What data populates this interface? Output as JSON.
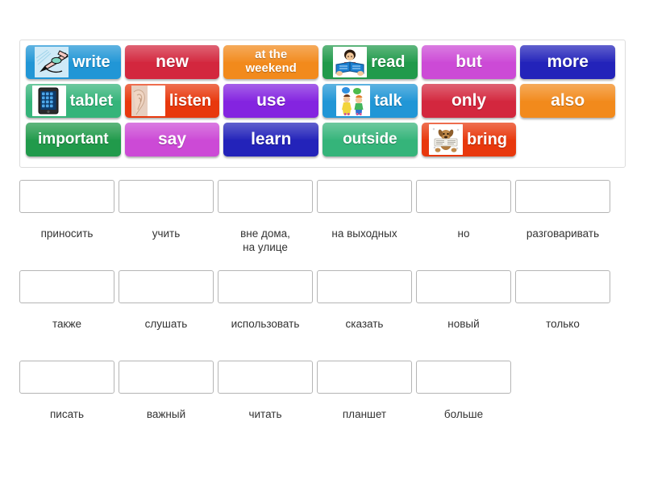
{
  "activity": {
    "type": "match-up-word-tiles",
    "tile_bank": {
      "rows": [
        [
          {
            "label": "write",
            "color": "#2196d6",
            "picture": "hand-writing-icon",
            "has_picture": true
          },
          {
            "label": "new",
            "color": "#d3273e",
            "picture": null,
            "has_picture": false
          },
          {
            "label": "at the\nweekend",
            "color": "#f28a1c",
            "picture": null,
            "has_picture": false,
            "two_line": true
          },
          {
            "label": "read",
            "color": "#219a4b",
            "picture": "child-reading-icon",
            "has_picture": true
          },
          {
            "label": "but",
            "color": "#cc4ad6",
            "picture": null,
            "has_picture": false
          },
          {
            "label": "more",
            "color": "#2323ba",
            "picture": null,
            "has_picture": false
          }
        ],
        [
          {
            "label": "tablet",
            "color": "#35b47a",
            "picture": "tablet-device-icon",
            "has_picture": true
          },
          {
            "label": "listen",
            "color": "#e8380d",
            "picture": "ear-listening-icon",
            "has_picture": true
          },
          {
            "label": "use",
            "color": "#8424e0",
            "picture": null,
            "has_picture": false
          },
          {
            "label": "talk",
            "color": "#2196d6",
            "picture": "two-kids-talking-icon",
            "has_picture": true
          },
          {
            "label": "only",
            "color": "#d3273e",
            "picture": null,
            "has_picture": false
          },
          {
            "label": "also",
            "color": "#f28a1c",
            "picture": null,
            "has_picture": false
          }
        ],
        [
          {
            "label": "important",
            "color": "#219a4b",
            "picture": null,
            "has_picture": false,
            "wordy": true
          },
          {
            "label": "say",
            "color": "#cc4ad6",
            "picture": null,
            "has_picture": false
          },
          {
            "label": "learn",
            "color": "#2323ba",
            "picture": null,
            "has_picture": false
          },
          {
            "label": "outside",
            "color": "#35b47a",
            "picture": null,
            "has_picture": false,
            "wordy": true
          },
          {
            "label": "bring",
            "color": "#e8380d",
            "picture": "dog-with-paper-icon",
            "has_picture": true
          },
          {
            "label": "",
            "color": "transparent",
            "picture": null,
            "has_picture": false,
            "empty": true
          }
        ]
      ]
    },
    "answer_rows": [
      [
        {
          "drop_value": "",
          "prompt": "приносить"
        },
        {
          "drop_value": "",
          "prompt": "учить"
        },
        {
          "drop_value": "",
          "prompt": "вне дома,\nна улице"
        },
        {
          "drop_value": "",
          "prompt": "на выходных"
        },
        {
          "drop_value": "",
          "prompt": "но"
        },
        {
          "drop_value": "",
          "prompt": "разговаривать"
        }
      ],
      [
        {
          "drop_value": "",
          "prompt": "также"
        },
        {
          "drop_value": "",
          "prompt": "слушать"
        },
        {
          "drop_value": "",
          "prompt": "использовать"
        },
        {
          "drop_value": "",
          "prompt": "сказать"
        },
        {
          "drop_value": "",
          "prompt": "новый"
        },
        {
          "drop_value": "",
          "prompt": "только"
        }
      ],
      [
        {
          "drop_value": "",
          "prompt": "писать"
        },
        {
          "drop_value": "",
          "prompt": "важный"
        },
        {
          "drop_value": "",
          "prompt": "читать"
        },
        {
          "drop_value": "",
          "prompt": "планшет"
        },
        {
          "drop_value": "",
          "prompt": "больше"
        },
        {
          "drop_value": "",
          "prompt": "",
          "empty": true
        }
      ]
    ]
  },
  "colors": {
    "tile_blue": "#2196d6",
    "tile_red": "#d3273e",
    "tile_orange": "#f28a1c",
    "tile_green": "#219a4b",
    "tile_magenta": "#cc4ad6",
    "tile_navy": "#2323ba",
    "tile_mint": "#35b47a",
    "tile_vermilion": "#e8380d",
    "tile_purple": "#8424e0",
    "bank_border": "#dcdcdc",
    "drop_border": "#b5b5b5",
    "prompt_text": "#333333",
    "page_background": "#ffffff"
  }
}
